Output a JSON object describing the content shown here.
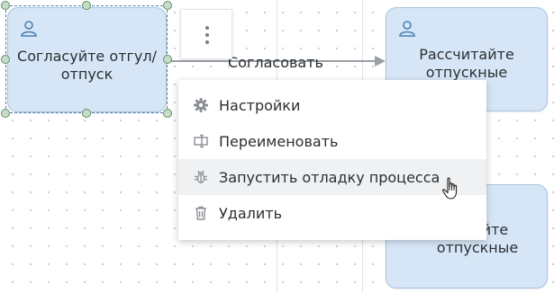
{
  "diagram": {
    "tasks": [
      {
        "id": "approve-leave",
        "label": "Согласуйте отгул/ отпуск",
        "icon": "user-icon",
        "selected": true
      },
      {
        "id": "calc-top",
        "label": "Рассчитайте отпускные",
        "icon": "user-icon"
      },
      {
        "id": "calc-bottom",
        "label": "читайте отпускные",
        "icon": "none"
      }
    ],
    "flow_label": "Согласовать"
  },
  "context_menu": {
    "trigger_icon": "more-vertical-icon",
    "items": [
      {
        "label": "Настройки",
        "icon": "gear-icon"
      },
      {
        "label": "Переименовать",
        "icon": "rename-icon"
      },
      {
        "label": "Запустить отладку процесса",
        "icon": "bug-icon",
        "hovered": true
      },
      {
        "label": "Удалить",
        "icon": "trash-icon"
      }
    ]
  },
  "colors": {
    "task_fill": "#d7e6f6",
    "task_border": "#a9c4df",
    "handle_fill": "#c8ddc8",
    "arrow": "#9aa0a6",
    "hover_row": "#f0f1f3"
  }
}
